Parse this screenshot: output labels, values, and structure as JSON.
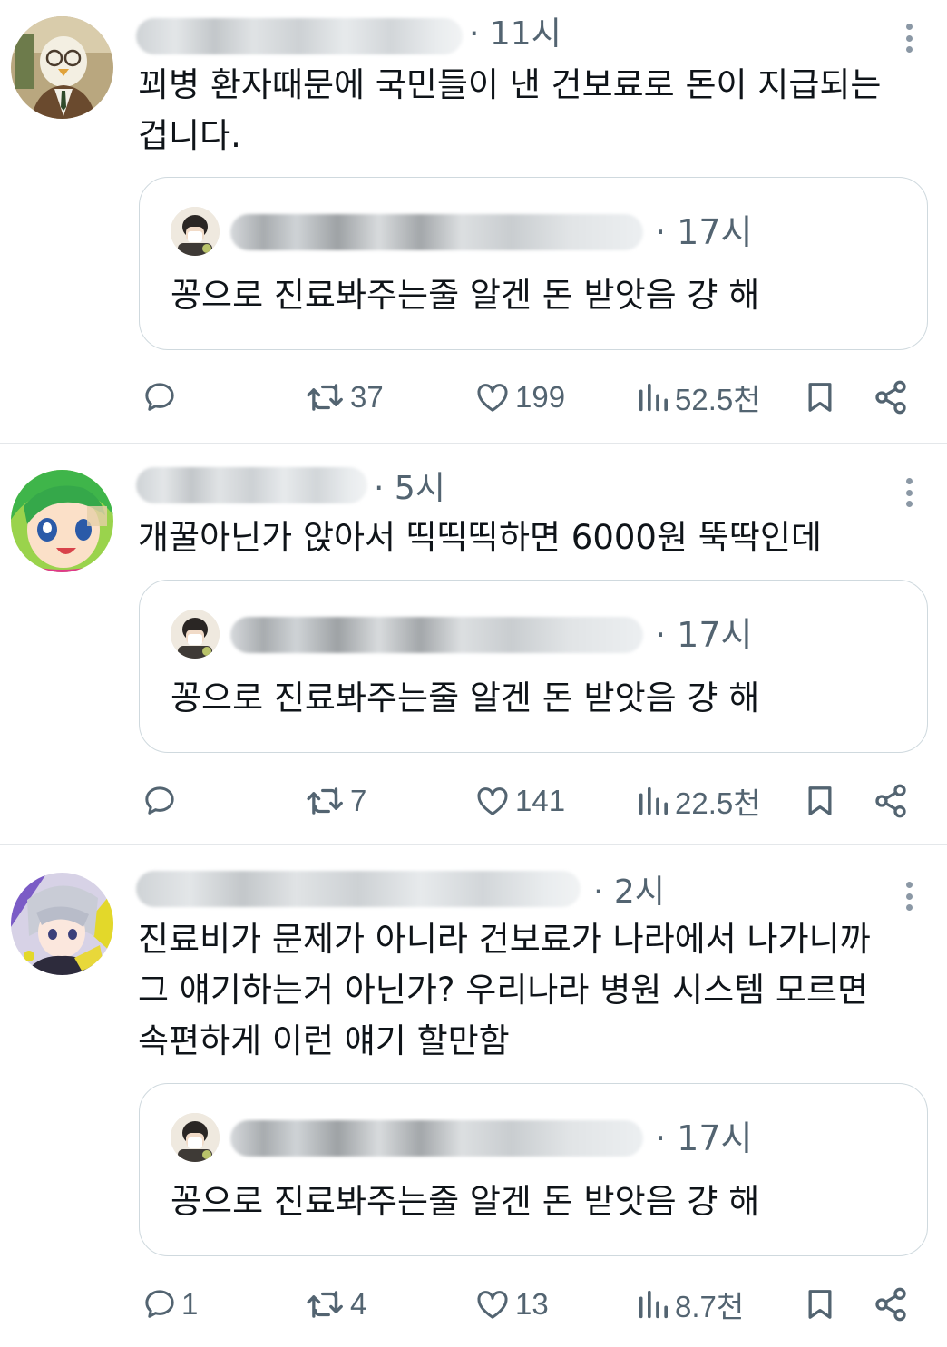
{
  "posts": [
    {
      "time": "· 11시",
      "text": "꾀병 환자때문에 국민들이 낸 건보료로 돈이 지급되는\n겁니다.",
      "quote": {
        "time": "· 17시",
        "text": "꽁으로 진료봐주는줄 알겐 돈 받앗음 걍 해"
      },
      "stats": {
        "replies": "",
        "reposts": "37",
        "likes": "199",
        "views": "52.5천"
      }
    },
    {
      "time": "· 5시",
      "text": "개꿀아닌가 앉아서 띡띡띡하면 6000원 뚝딱인데",
      "quote": {
        "time": "· 17시",
        "text": "꽁으로 진료봐주는줄 알겐 돈 받앗음 걍 해"
      },
      "stats": {
        "replies": "",
        "reposts": "7",
        "likes": "141",
        "views": "22.5천"
      }
    },
    {
      "time": "· 2시",
      "text": "진료비가 문제가 아니라 건보료가 나라에서 나가니까\n그 얘기하는거 아닌가? 우리나라 병원 시스템 모르면\n속편하게 이런 얘기 할만함",
      "quote": {
        "time": "· 17시",
        "text": "꽁으로 진료봐주는줄 알겐 돈 받앗음 걍 해"
      },
      "stats": {
        "replies": "1",
        "reposts": "4",
        "likes": "13",
        "views": "8.7천"
      }
    }
  ],
  "icons": {
    "reply": "speech-bubble-icon",
    "repost": "repost-arrows-icon",
    "like": "heart-icon",
    "views": "bar-chart-icon",
    "bookmark": "bookmark-icon",
    "share": "share-icon",
    "more": "vertical-dots-icon"
  },
  "colors": {
    "text": "#0f1419",
    "secondary": "#536471",
    "border": "#cfd9de"
  }
}
